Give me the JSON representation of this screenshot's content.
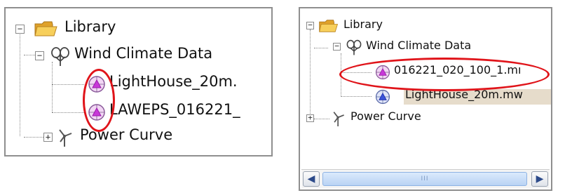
{
  "left_tree": {
    "root_label": "Library",
    "wind_label": "Wind Climate Data",
    "file1": "LightHouse_20m.",
    "file2": "LAWEPS_016221_",
    "power_label": "Power Curve",
    "collapse_glyph": "−",
    "expand_glyph": "+"
  },
  "right_tree": {
    "root_label": "Library",
    "wind_label": "Wind Climate Data",
    "file1": "016221_020_100_1.mı",
    "file2": "LightHouse_20m.mw",
    "power_label": "Power Curve",
    "collapse_glyph": "−",
    "expand_glyph": "+"
  },
  "scrollbar": {
    "left_arrow": "◀",
    "right_arrow": "▶",
    "thumb_grip": "III"
  },
  "colors": {
    "highlight": "#e0141a",
    "folder": "#f3c14a",
    "selected_row": "#e6dccb",
    "wind_file_icon": "#c838d8"
  },
  "icons": [
    "folder-icon",
    "wind-climate-icon",
    "wind-file-icon",
    "wind-turbine-icon"
  ]
}
